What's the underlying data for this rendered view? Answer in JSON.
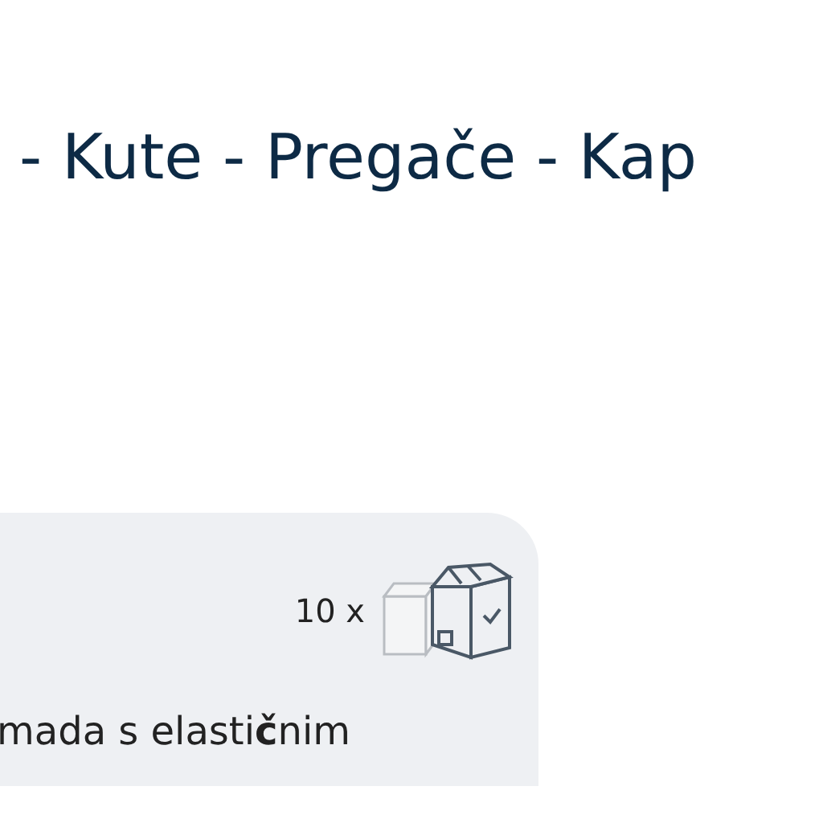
{
  "heading": "- Kute - Pregače - Kap",
  "card": {
    "quantity": "10 x",
    "description": "mada s elasti**č**nim"
  }
}
